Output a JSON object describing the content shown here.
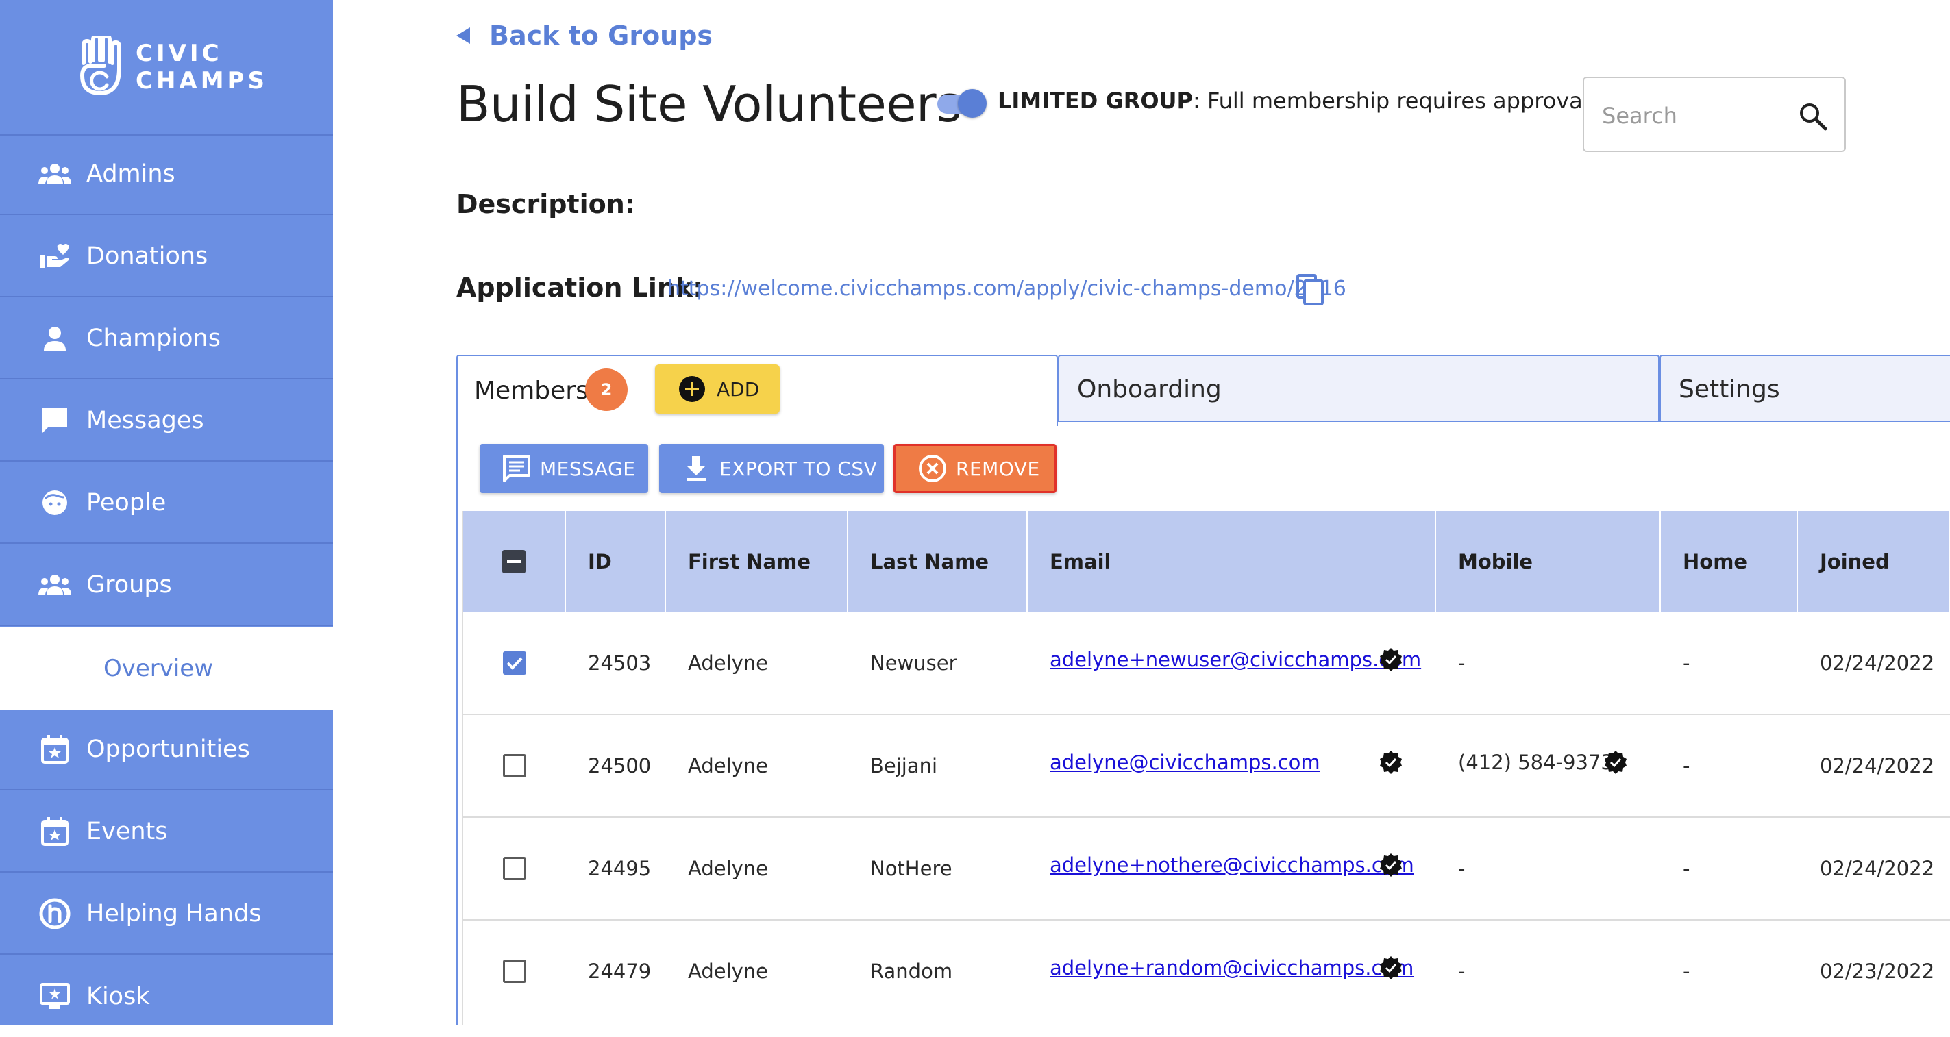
{
  "brand": {
    "logo_line1": "CIVIC",
    "logo_line2": "CHAMPS"
  },
  "sidebar": {
    "items": [
      {
        "label": "Admins",
        "icon": "admins-icon"
      },
      {
        "label": "Donations",
        "icon": "donations-icon"
      },
      {
        "label": "Champions",
        "icon": "champions-icon"
      },
      {
        "label": "Messages",
        "icon": "messages-icon"
      },
      {
        "label": "People",
        "icon": "people-icon"
      },
      {
        "label": "Groups",
        "icon": "groups-icon"
      },
      {
        "label": "Opportunities",
        "icon": "opportunities-icon"
      },
      {
        "label": "Events",
        "icon": "events-icon"
      },
      {
        "label": "Helping Hands",
        "icon": "helping-hands-icon"
      },
      {
        "label": "Kiosk",
        "icon": "kiosk-icon"
      }
    ],
    "sub_item": {
      "label": "Overview"
    }
  },
  "header": {
    "back_label": "Back to Groups",
    "title": "Build Site Volunteers",
    "limited_group_label": "LIMITED GROUP",
    "limited_group_text": ": Full membership requires approval.",
    "limited_group_enabled": true
  },
  "search": {
    "placeholder": "Search"
  },
  "details": {
    "description_label": "Description:",
    "application_link_label": "Application Link:",
    "application_link_url": "https://welcome.civicchamps.com/apply/civic-champs-demo/2816"
  },
  "tabs": {
    "members_label": "Members",
    "members_count": "2",
    "add_label": "ADD",
    "onboarding_label": "Onboarding",
    "settings_label": "Settings"
  },
  "actions": {
    "message": "MESSAGE",
    "export": "EXPORT TO CSV",
    "remove": "REMOVE"
  },
  "table": {
    "columns": [
      "ID",
      "First Name",
      "Last Name",
      "Email",
      "Mobile",
      "Home",
      "Joined"
    ],
    "rows": [
      {
        "checked": true,
        "id": "24503",
        "first": "Adelyne",
        "last": "Newuser",
        "email": "adelyne+newuser@civicchamps.com",
        "email_verified": true,
        "mobile": "-",
        "mobile_verified": false,
        "home": "-",
        "joined": "02/24/2022"
      },
      {
        "checked": false,
        "id": "24500",
        "first": "Adelyne",
        "last": "Bejjani",
        "email": "adelyne@civicchamps.com",
        "email_verified": true,
        "mobile": "(412) 584-9373",
        "mobile_verified": true,
        "home": "-",
        "joined": "02/24/2022"
      },
      {
        "checked": false,
        "id": "24495",
        "first": "Adelyne",
        "last": "NotHere",
        "email": "adelyne+nothere@civicchamps.com",
        "email_verified": true,
        "mobile": "-",
        "mobile_verified": false,
        "home": "-",
        "joined": "02/24/2022"
      },
      {
        "checked": false,
        "id": "24479",
        "first": "Adelyne",
        "last": "Random",
        "email": "adelyne+random@civicchamps.com",
        "email_verified": true,
        "mobile": "-",
        "mobile_verified": false,
        "home": "-",
        "joined": "02/23/2022"
      }
    ]
  },
  "colors": {
    "sidebar_bg": "#6b8fe3",
    "accent": "#5a7fd6",
    "add_button": "#f6d24b",
    "remove_button": "#ef7b45",
    "badge": "#ef7b45",
    "table_header": "#bccaf0"
  }
}
